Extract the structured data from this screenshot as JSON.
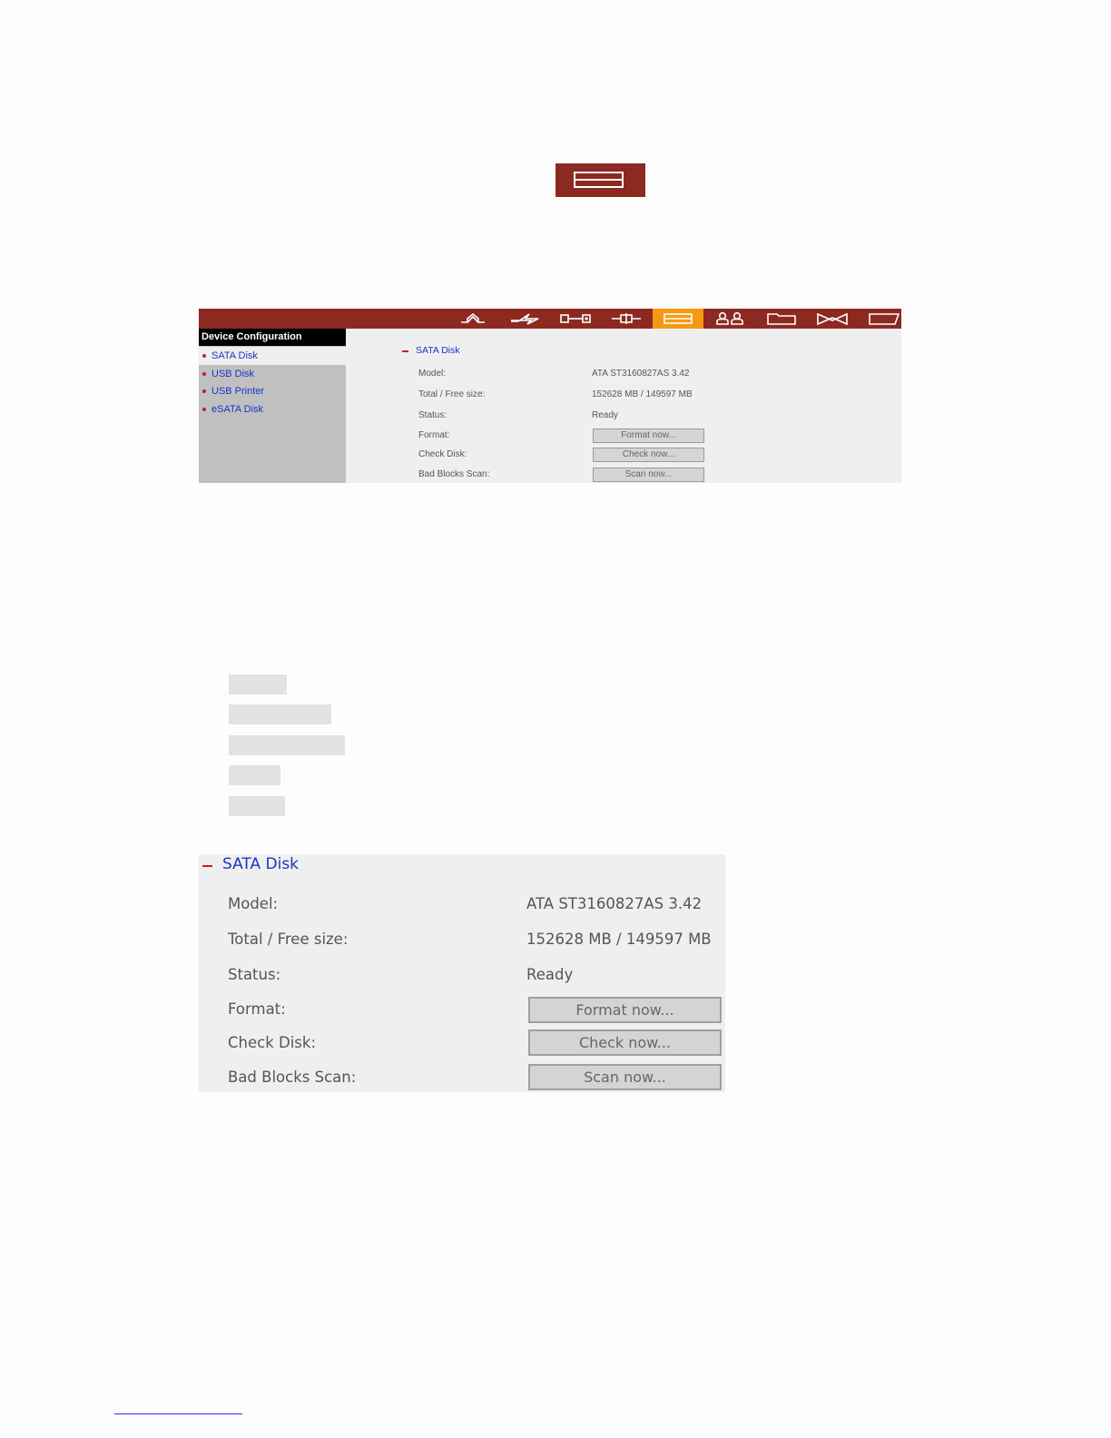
{
  "toolbar_icons": [
    "home-icon",
    "lightning-icon",
    "network-icon",
    "plug-icon",
    "storage-icon",
    "users-icon",
    "folder-icon",
    "bowtie-icon",
    "note-icon"
  ],
  "sidebar": {
    "title": "Device Configuration",
    "items": [
      {
        "label": "SATA Disk",
        "selected": true
      },
      {
        "label": "USB Disk",
        "selected": false
      },
      {
        "label": "USB Printer",
        "selected": false
      },
      {
        "label": "eSATA Disk",
        "selected": false
      }
    ]
  },
  "panel": {
    "heading": "SATA Disk",
    "rows": {
      "model": {
        "label": "Model:",
        "value": "ATA ST3160827AS 3.42"
      },
      "size": {
        "label": "Total / Free size:",
        "value": "152628 MB / 149597 MB"
      },
      "status": {
        "label": "Status:",
        "value": "Ready"
      },
      "format": {
        "label": "Format:",
        "button": "Format now..."
      },
      "check": {
        "label": "Check Disk:",
        "button": "Check now..."
      },
      "scan": {
        "label": "Bad Blocks Scan:",
        "button": "Scan now..."
      }
    }
  },
  "colors": {
    "toolbar": "#8c2a22",
    "active_tab": "#f49a12",
    "link": "#1a35c8",
    "bullet": "#d01a1a"
  }
}
